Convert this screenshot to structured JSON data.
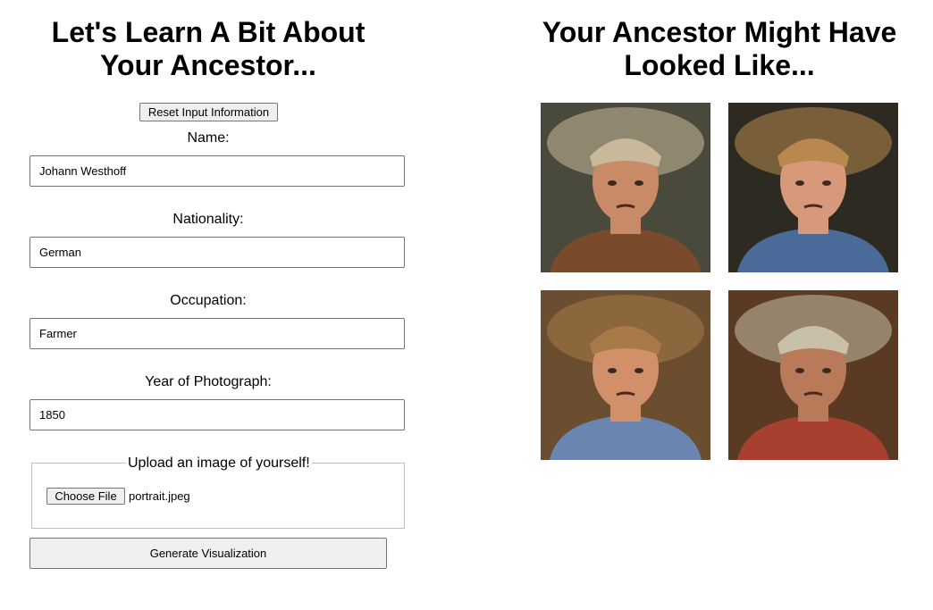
{
  "left_panel": {
    "heading_line1": "Let's Learn A Bit About",
    "heading_line2": "Your Ancestor...",
    "reset_label": "Reset Input Information",
    "name_label": "Name:",
    "name_value": "Johann Westhoff",
    "nationality_label": "Nationality:",
    "nationality_value": "German",
    "occupation_label": "Occupation:",
    "occupation_value": "Farmer",
    "year_label": "Year of Photograph:",
    "year_value": "1850",
    "upload_legend": "Upload an image of yourself!",
    "choose_file_label": "Choose File",
    "file_name": "portrait.jpeg",
    "generate_label": "Generate Visualization"
  },
  "right_panel": {
    "heading_line1": "Your Ancestor Might Have",
    "heading_line2": "Looked Like...",
    "portraits": [
      {
        "bg": "#4a4a3c",
        "skin": "#c98a68",
        "hat": "#c9b99a",
        "shirt": "#7a4a2c"
      },
      {
        "bg": "#2d2a22",
        "skin": "#d8987a",
        "hat": "#b8884e",
        "shirt": "#4a6a9a"
      },
      {
        "bg": "#6b4e30",
        "skin": "#d1906a",
        "hat": "#a87a48",
        "shirt": "#6a86b0"
      },
      {
        "bg": "#5a3a22",
        "skin": "#b87a58",
        "hat": "#c8c0a8",
        "shirt": "#a84030"
      }
    ]
  }
}
